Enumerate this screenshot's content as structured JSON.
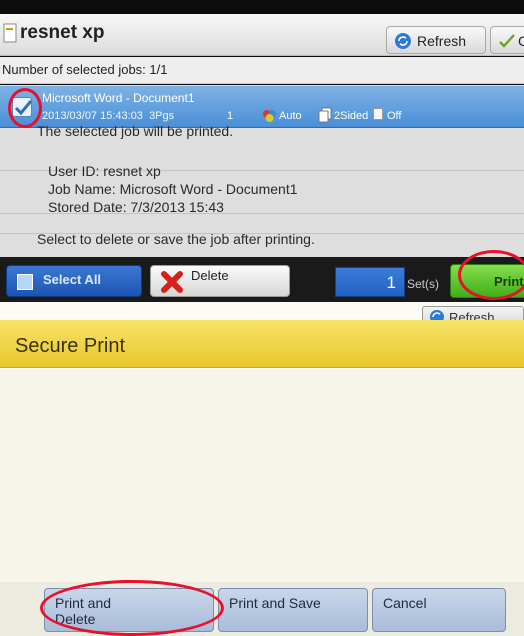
{
  "top_screen": {
    "title": "resnet xp",
    "refresh_label": "Refresh",
    "close_label": "C",
    "selected_count": "Number of selected jobs: 1/1",
    "job": {
      "name": "Microsoft Word - Document1",
      "date": "2013/03/07 15:43:03",
      "pages": "3Pgs",
      "copies": "1",
      "color": "Auto",
      "sides": "2Sided",
      "staple": "Off"
    },
    "select_all_label": "Select All",
    "delete_label": "Delete",
    "sets_value": "1",
    "sets_label": "Set(s)",
    "print_label": "Print"
  },
  "bottom_screen": {
    "top_refresh_label": "Refresh",
    "title": "Secure Print",
    "message": "The selected job will be printed.",
    "user_id": "User ID: resnet xp",
    "job_name": "Job Name: Microsoft Word - Document1",
    "stored_date": "Stored Date: 7/3/2013 15:43",
    "instruction": "Select to delete or save the job after printing.",
    "print_delete_line1": "Print and",
    "print_delete_line2": "Delete",
    "print_save_label": "Print and Save",
    "cancel_label": "Cancel"
  },
  "colors": {
    "accent_blue": "#4a8fd7",
    "print_green": "#3fae19",
    "dialog_yellow": "#e8c72c",
    "highlight_red": "#e8102a"
  },
  "icons": [
    "document-icon",
    "refresh-icon",
    "checkmark-icon",
    "color-mode-icon",
    "duplex-icon",
    "staple-icon",
    "select-all-icon",
    "delete-x-icon"
  ]
}
